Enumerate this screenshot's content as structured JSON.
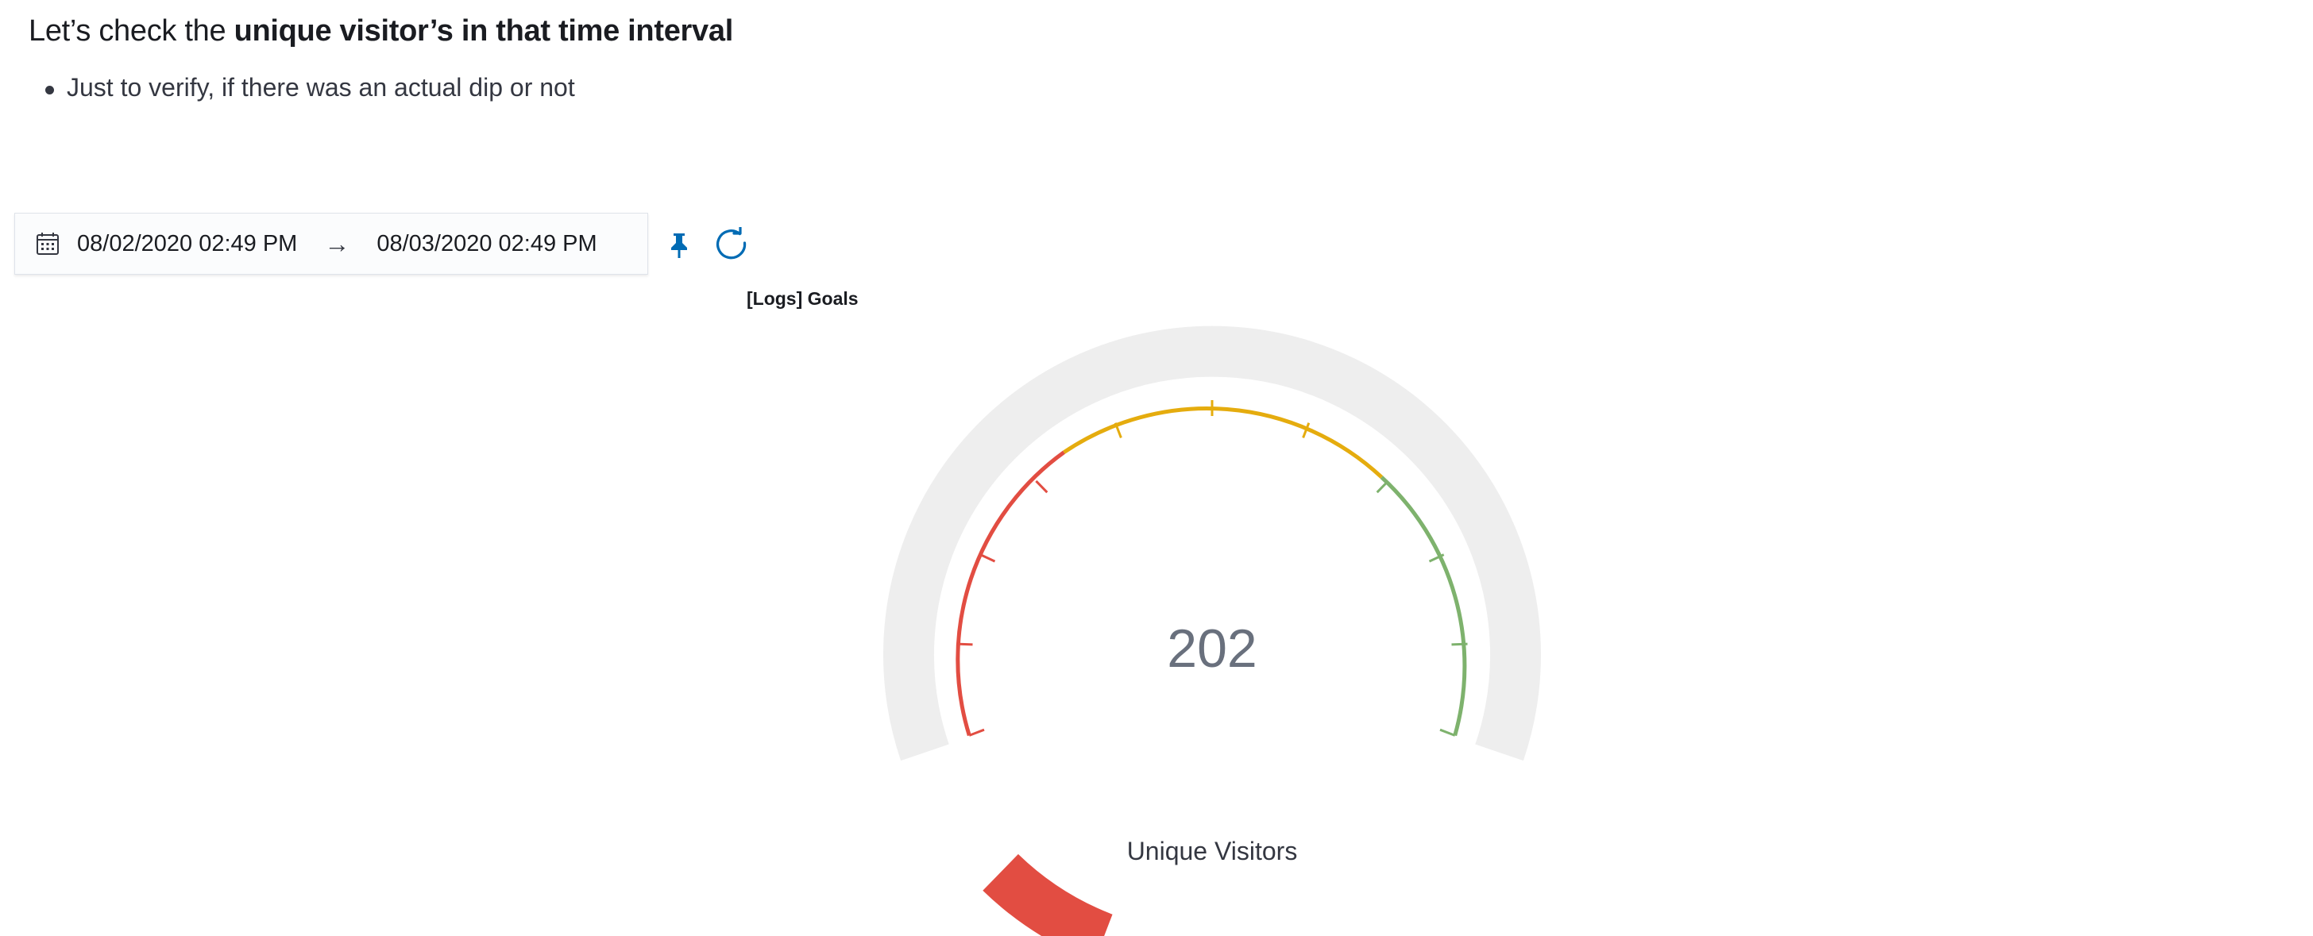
{
  "heading": {
    "prefix": "Let’s check the",
    "emphasis": "unique visitor’s in that time interval"
  },
  "bullets": [
    "Just to verify, if there was an actual dip or not"
  ],
  "date_picker": {
    "start": "08/02/2020 02:49 PM",
    "arrow": "→",
    "end": "08/03/2020 02:49 PM",
    "icons": [
      "calendar-icon",
      "pin-icon",
      "refresh-icon"
    ]
  },
  "panel": {
    "title": "[Logs] Goals"
  },
  "gauge": {
    "value": "202",
    "label": "Unique Visitors",
    "filled_fraction": 0.09,
    "colors": {
      "track": "#eeeeee",
      "fill": "#e24d42",
      "low": "#e24d42",
      "mid": "#e5ac0e",
      "high": "#7eb26d",
      "value_text": "#69707d",
      "accent": "#006bb4"
    }
  }
}
